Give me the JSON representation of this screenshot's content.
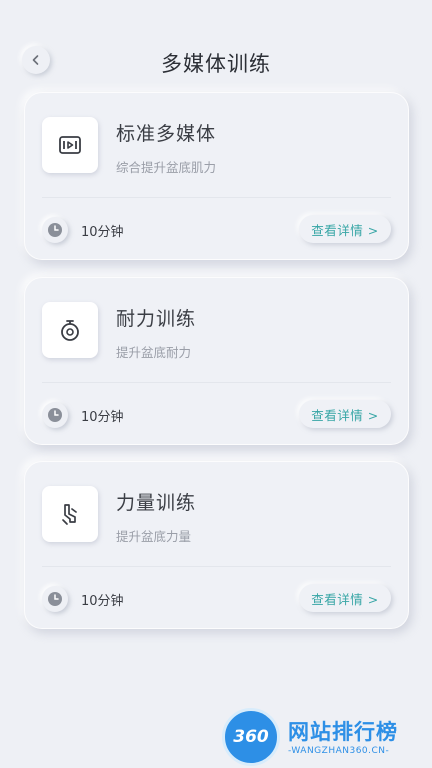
{
  "header": {
    "title": "多媒体训练",
    "back_icon": "chevron-left-icon"
  },
  "cards": [
    {
      "title": "标准多媒体",
      "subtitle": "综合提升盆底肌力",
      "icon": "video-icon",
      "duration": "10分钟",
      "detail_label": "查看详情 >"
    },
    {
      "title": "耐力训练",
      "subtitle": "提升盆底耐力",
      "icon": "stopwatch-icon",
      "duration": "10分钟",
      "detail_label": "查看详情 >"
    },
    {
      "title": "力量训练",
      "subtitle": "提升盆底力量",
      "icon": "strength-icon",
      "duration": "10分钟",
      "detail_label": "查看详情 >"
    }
  ],
  "watermark": {
    "logo_text": "360",
    "name": "网站排行榜",
    "url": "-WANGZHAN360.CN-"
  },
  "colors": {
    "background": "#eef0f5",
    "accent": "#38a6a6",
    "watermark": "#2d8fe6"
  }
}
